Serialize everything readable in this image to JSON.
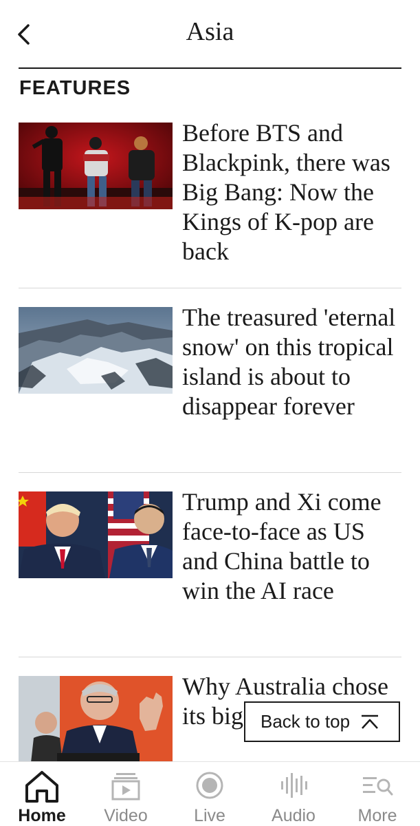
{
  "header": {
    "title": "Asia",
    "back_icon": "chevron-left-icon"
  },
  "section": {
    "title": "FEATURES"
  },
  "articles": [
    {
      "headline": "Before BTS and Blackpink, there was Big Bang: Now the Kings of K-pop are back",
      "image": "concert-stage-image"
    },
    {
      "headline": "The treasured 'eternal snow' on this tropical island is about to disappear forever",
      "image": "snowy-mountain-image"
    },
    {
      "headline": "Trump and Xi come face-to-face as US and China battle to win the AI race",
      "image": "leaders-flags-image"
    },
    {
      "headline": "Why Australia chose its biggest political",
      "image": "speaker-podium-image"
    }
  ],
  "back_to_top": {
    "label": "Back to top",
    "icon": "chevron-up-icon"
  },
  "tabbar": {
    "items": [
      {
        "label": "Home",
        "icon": "home-icon",
        "active": true
      },
      {
        "label": "Video",
        "icon": "video-icon",
        "active": false
      },
      {
        "label": "Live",
        "icon": "live-icon",
        "active": false
      },
      {
        "label": "Audio",
        "icon": "audio-icon",
        "active": false
      },
      {
        "label": "More",
        "icon": "more-icon",
        "active": false
      }
    ]
  },
  "colors": {
    "text": "#1a1a1a",
    "inactive_tab": "#8a8a8a",
    "divider": "#d8d8d8",
    "background": "#ffffff"
  }
}
